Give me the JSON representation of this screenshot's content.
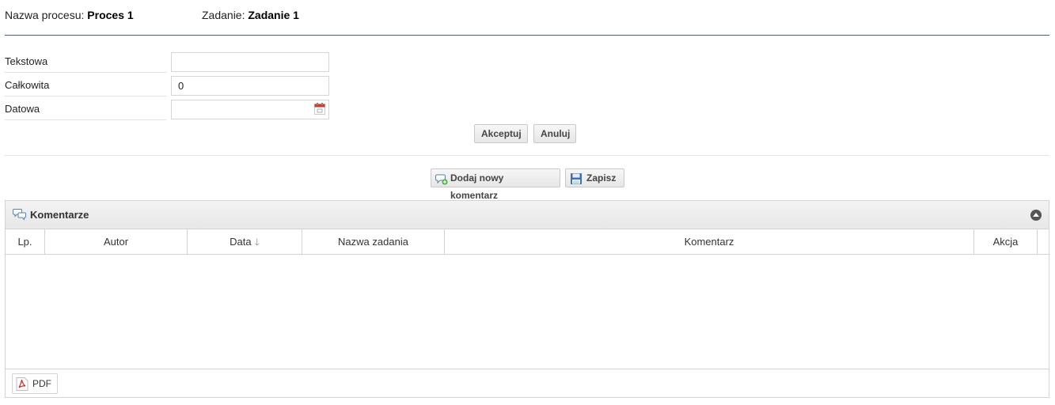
{
  "header": {
    "process_label": "Nazwa procesu:",
    "process_value": "Proces 1",
    "task_label": "Zadanie:",
    "task_value": "Zadanie 1"
  },
  "form": {
    "fields": [
      {
        "label": "Tekstowa",
        "value": ""
      },
      {
        "label": "Całkowita",
        "value": "0"
      },
      {
        "label": "Datowa",
        "value": ""
      }
    ],
    "accept_label": "Akceptuj",
    "cancel_label": "Anuluj"
  },
  "actions": {
    "add_comment_label": "Dodaj nowy komentarz",
    "save_label": "Zapisz"
  },
  "comments": {
    "title": "Komentarze",
    "columns": [
      "Lp.",
      "Autor",
      "Data",
      "Nazwa zadania",
      "Komentarz",
      "Akcja"
    ],
    "rows": [],
    "pdf_label": "PDF"
  },
  "colors": {
    "divider": "#4a5f7e",
    "panel_header": "#ececec",
    "pdf_red": "#c8302c"
  }
}
